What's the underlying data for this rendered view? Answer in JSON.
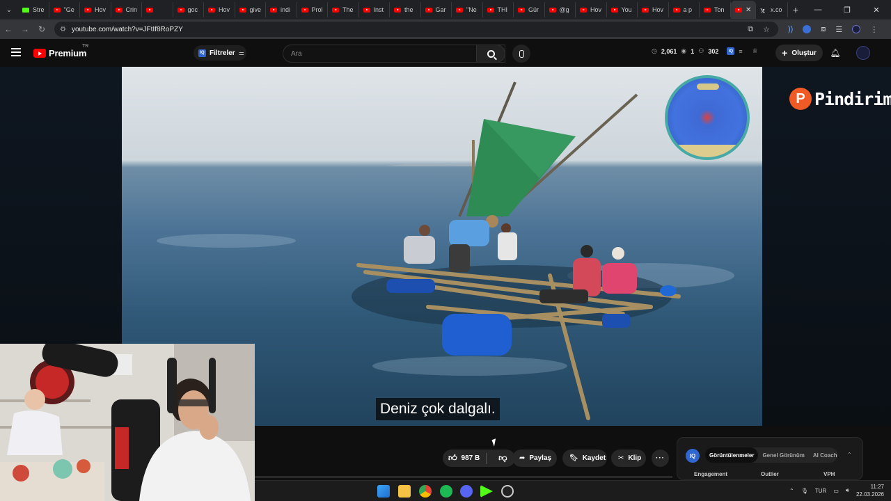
{
  "browser": {
    "tabs": [
      {
        "label": "Stre",
        "icon": "kick-icon"
      },
      {
        "label": "\"Ge",
        "icon": "youtube-icon"
      },
      {
        "label": "Hov",
        "icon": "youtube-icon"
      },
      {
        "label": "Crin",
        "icon": "youtube-icon"
      },
      {
        "label": "",
        "icon": "youtube-icon"
      },
      {
        "label": "goc",
        "icon": "youtube-icon"
      },
      {
        "label": "Hov",
        "icon": "youtube-icon"
      },
      {
        "label": "give",
        "icon": "youtube-icon"
      },
      {
        "label": "indi",
        "icon": "youtube-icon"
      },
      {
        "label": "Prol",
        "icon": "youtube-icon"
      },
      {
        "label": "The",
        "icon": "youtube-icon"
      },
      {
        "label": "Inst",
        "icon": "youtube-icon"
      },
      {
        "label": "the",
        "icon": "youtube-icon"
      },
      {
        "label": "Gar",
        "icon": "youtube-icon"
      },
      {
        "label": "\"Ne",
        "icon": "youtube-icon"
      },
      {
        "label": "THI",
        "icon": "youtube-icon"
      },
      {
        "label": "Gür",
        "icon": "youtube-icon"
      },
      {
        "label": "@g",
        "icon": "youtube-icon"
      },
      {
        "label": "Hov",
        "icon": "youtube-icon"
      },
      {
        "label": "You",
        "icon": "youtube-icon"
      },
      {
        "label": "Hov",
        "icon": "youtube-icon"
      },
      {
        "label": "a p",
        "icon": "youtube-icon"
      },
      {
        "label": "Ton",
        "icon": "youtube-icon"
      }
    ],
    "active_tab_label": "",
    "last_tab_label": "x.co",
    "url": "youtube.com/watch?v=JFtIf8RoPZY"
  },
  "header": {
    "brand": "Premium",
    "region": "TR",
    "filters_label": "Filtreler",
    "search_placeholder": "Ara",
    "stats": {
      "views": "2,061",
      "eye": "1",
      "count": "302"
    },
    "create_label": "Oluştur"
  },
  "video": {
    "subtitle": "Deniz çok dalgalı.",
    "sponsor_text": "Pindirim",
    "sponsor_letter": "P"
  },
  "actions": {
    "likes": "987 B",
    "share_label": "Paylaş",
    "save_label": "Kaydet",
    "clip_label": "Klip",
    "more_label": "···"
  },
  "vidiq": {
    "logo": "IQ",
    "tabs": [
      "Görüntülenmeler",
      "Genel Görünüm",
      "AI Coach"
    ],
    "columns": [
      "Engagement",
      "Outlier",
      "VPH"
    ]
  },
  "taskbar": {
    "language": "TUR",
    "time": "11:27",
    "date": "22.03.2026"
  },
  "colors": {
    "youtube_red": "#ff0000",
    "vidiq_blue": "#2f66d0",
    "kick_green": "#53fc18",
    "sponsor_orange": "#f05a24"
  }
}
